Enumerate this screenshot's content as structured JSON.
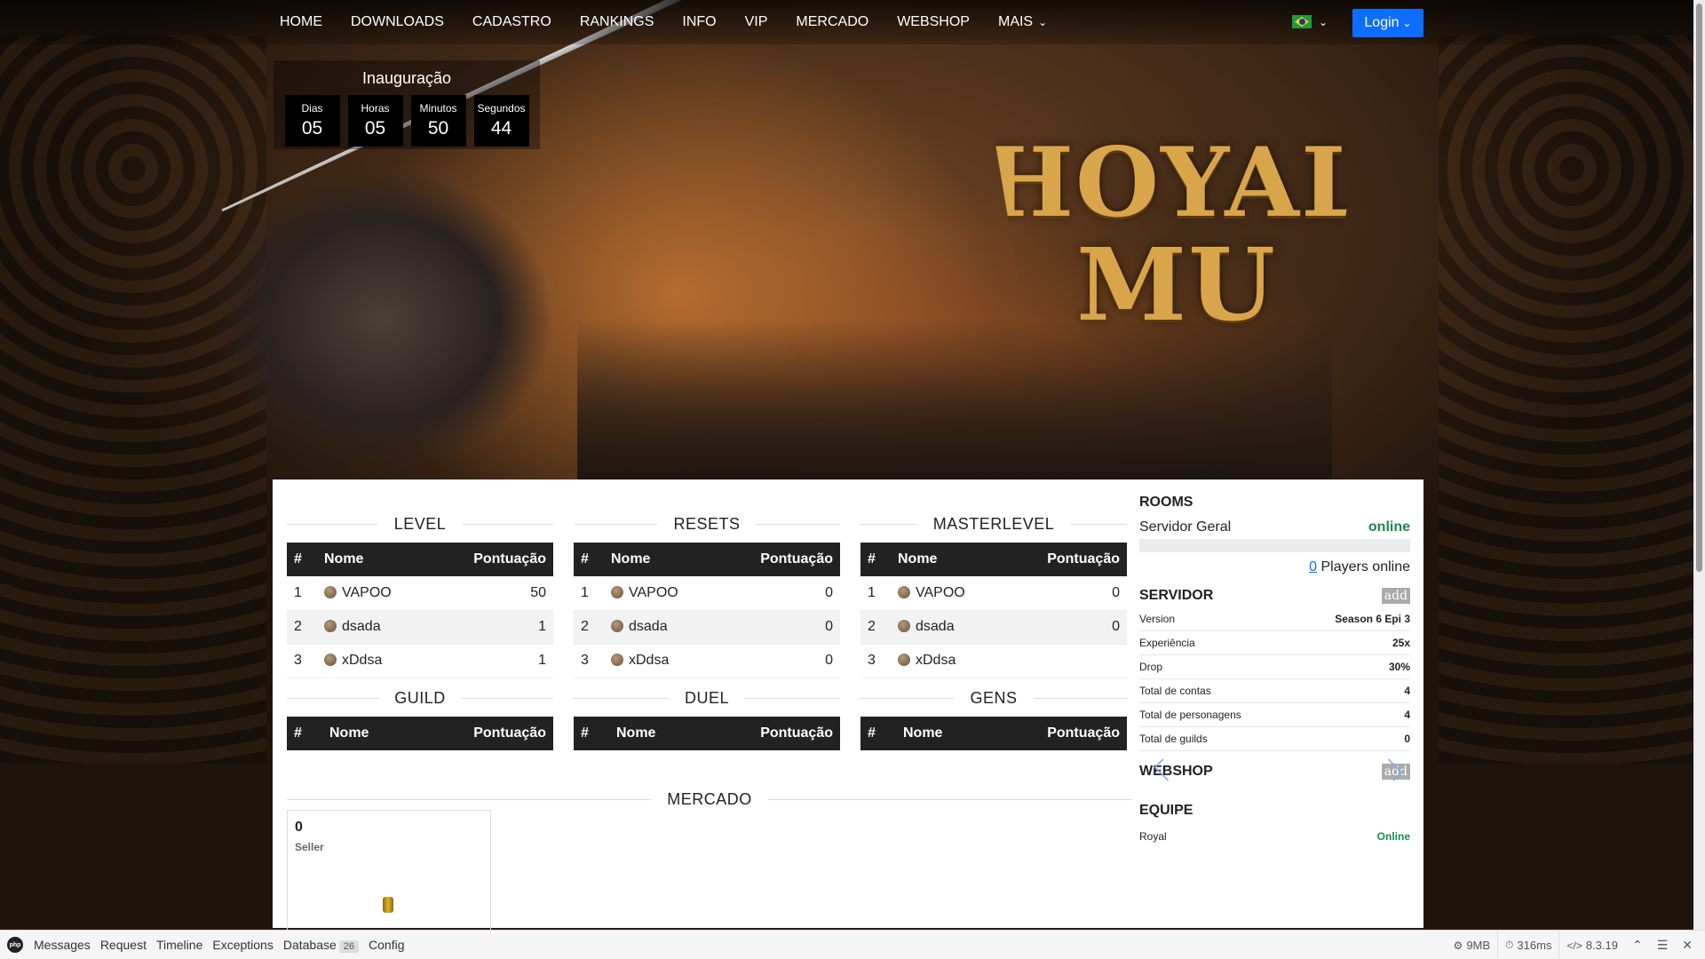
{
  "nav": {
    "items": [
      "HOME",
      "DOWNLOADS",
      "CADASTRO",
      "RANKINGS",
      "INFO",
      "VIP",
      "MERCADO",
      "WEBSHOP"
    ],
    "more": "MAIS",
    "login": "Login"
  },
  "countdown": {
    "title": "Inauguração",
    "units": [
      {
        "label": "Dias",
        "value": "05"
      },
      {
        "label": "Horas",
        "value": "05"
      },
      {
        "label": "Minutos",
        "value": "50"
      },
      {
        "label": "Segundos",
        "value": "44"
      }
    ]
  },
  "logo": {
    "line1": "HOYAL",
    "line2": "MU"
  },
  "rankings": {
    "headers": {
      "pos": "#",
      "name": "Nome",
      "score": "Pontuação"
    },
    "level": {
      "title": "LEVEL",
      "rows": [
        {
          "pos": "1",
          "name": "VAPOO",
          "score": "50"
        },
        {
          "pos": "2",
          "name": "dsada",
          "score": "1"
        },
        {
          "pos": "3",
          "name": "xDdsa",
          "score": "1"
        }
      ]
    },
    "resets": {
      "title": "RESETS",
      "rows": [
        {
          "pos": "1",
          "name": "VAPOO",
          "score": "0"
        },
        {
          "pos": "2",
          "name": "dsada",
          "score": "0"
        },
        {
          "pos": "3",
          "name": "xDdsa",
          "score": "0"
        }
      ]
    },
    "masterlevel": {
      "title": "MASTERLEVEL",
      "rows": [
        {
          "pos": "1",
          "name": "VAPOO",
          "score": "0"
        },
        {
          "pos": "2",
          "name": "dsada",
          "score": "0"
        },
        {
          "pos": "3",
          "name": "xDdsa",
          "score": ""
        }
      ]
    },
    "guild": {
      "title": "GUILD"
    },
    "duel": {
      "title": "DUEL"
    },
    "gens": {
      "title": "GENS"
    }
  },
  "mercado": {
    "title": "MERCADO",
    "card": {
      "count": "0",
      "seller": "Seller"
    }
  },
  "sidebar": {
    "rooms": {
      "title": "ROOMS",
      "server": "Servidor Geral",
      "status": "online",
      "players_count": "0",
      "players_label": "Players online"
    },
    "servidor": {
      "title": "SERVIDOR",
      "add": "add",
      "rows": [
        {
          "label": "Version",
          "value": "Season 6 Epi 3"
        },
        {
          "label": "Experiência",
          "value": "25x"
        },
        {
          "label": "Drop",
          "value": "30%"
        },
        {
          "label": "Total de contas",
          "value": "4"
        },
        {
          "label": "Total de personagens",
          "value": "4"
        },
        {
          "label": "Total de guilds",
          "value": "0"
        }
      ]
    },
    "webshop": {
      "title": "WEBSHOP",
      "add": "add"
    },
    "equipe": {
      "title": "EQUIPE",
      "member": "Royal",
      "status": "Online"
    }
  },
  "debugbar": {
    "logo": "php",
    "tabs": [
      "Messages",
      "Request",
      "Timeline",
      "Exceptions",
      "Database",
      "Config"
    ],
    "database_count": "26",
    "memory": "9MB",
    "time": "316ms",
    "version": "8.3.19"
  },
  "colors": {
    "accent": "#0d6efd",
    "online": "#198754",
    "table_header": "#222222",
    "logo_gold": "#d9a54a"
  }
}
